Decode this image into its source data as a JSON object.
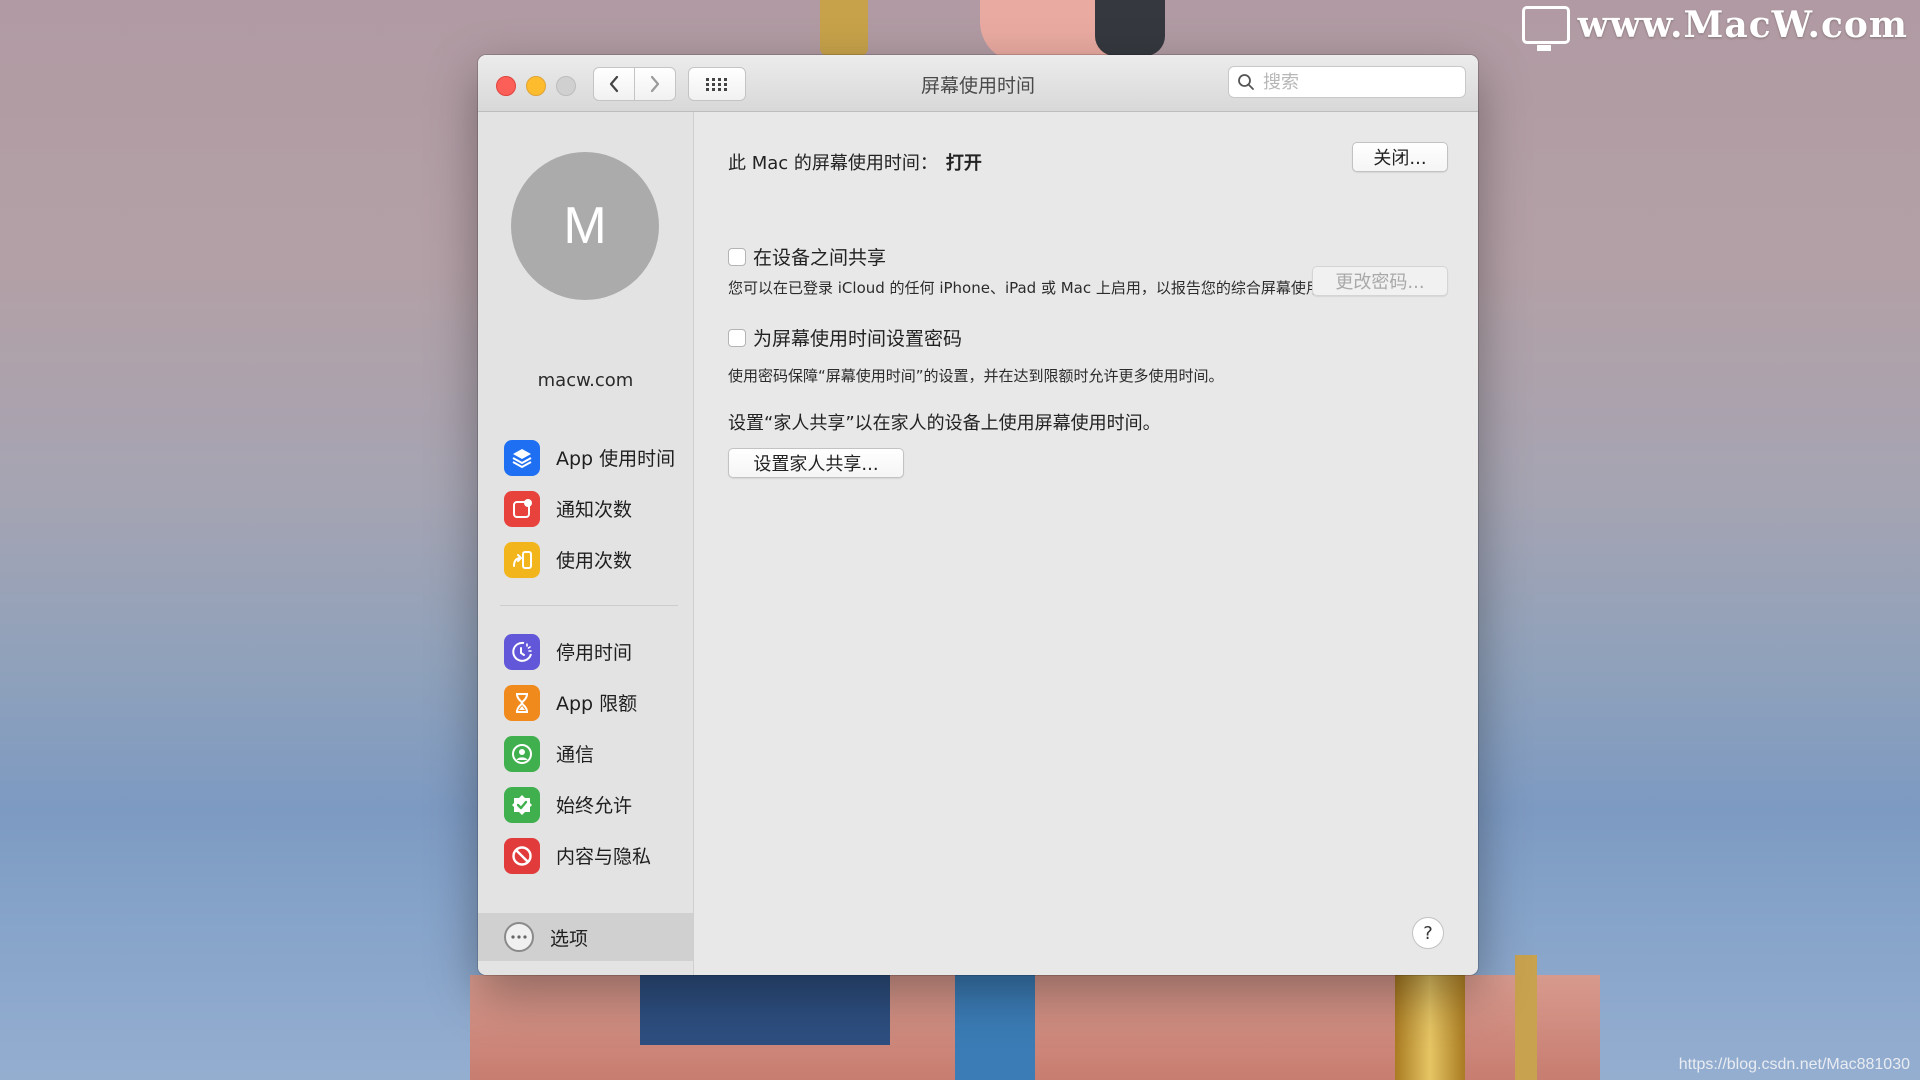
{
  "watermark": {
    "text": "www.MacW.com",
    "icon": "monitor-icon"
  },
  "blog_url": "https://blog.csdn.net/Mac881030",
  "window": {
    "title": "屏幕使用时间",
    "search_placeholder": "搜索"
  },
  "sidebar": {
    "avatar_letter": "M",
    "username": "macw.com",
    "group1": [
      {
        "label": "App 使用时间",
        "icon": "stack-layers-icon",
        "color": "#1e6ff1"
      },
      {
        "label": "通知次数",
        "icon": "notification-badge-icon",
        "color": "#e8423c"
      },
      {
        "label": "使用次数",
        "icon": "pickup-phone-icon",
        "color": "#f2b51c"
      }
    ],
    "group2": [
      {
        "label": "停用时间",
        "icon": "downtime-moon-clock-icon",
        "color": "#6157d8"
      },
      {
        "label": "App 限额",
        "icon": "hourglass-icon",
        "color": "#f08a1d"
      },
      {
        "label": "通信",
        "icon": "person-contact-icon",
        "color": "#3fb04d"
      },
      {
        "label": "始终允许",
        "icon": "checkmark-shield-icon",
        "color": "#3fb04d"
      },
      {
        "label": "内容与隐私",
        "icon": "no-entry-icon",
        "color": "#e23b3b"
      }
    ],
    "options_label": "选项"
  },
  "content": {
    "status_label": "此 Mac 的屏幕使用时间：",
    "status_value": "打开",
    "off_button": "关闭...",
    "share_checkbox": {
      "label": "在设备之间共享",
      "checked": false
    },
    "share_desc": "您可以在已登录 iCloud 的任何 iPhone、iPad 或 Mac 上启用，以报告您的综合屏幕使用时间。",
    "passcode_checkbox": {
      "label": "为屏幕使用时间设置密码",
      "checked": false
    },
    "change_passcode_button": "更改密码...",
    "passcode_desc": "使用密码保障“屏幕使用时间”的设置，并在达到限额时允许更多使用时间。",
    "family_text": "设置“家人共享”以在家人的设备上使用屏幕使用时间。",
    "family_button": "设置家人共享...",
    "help": "?"
  }
}
